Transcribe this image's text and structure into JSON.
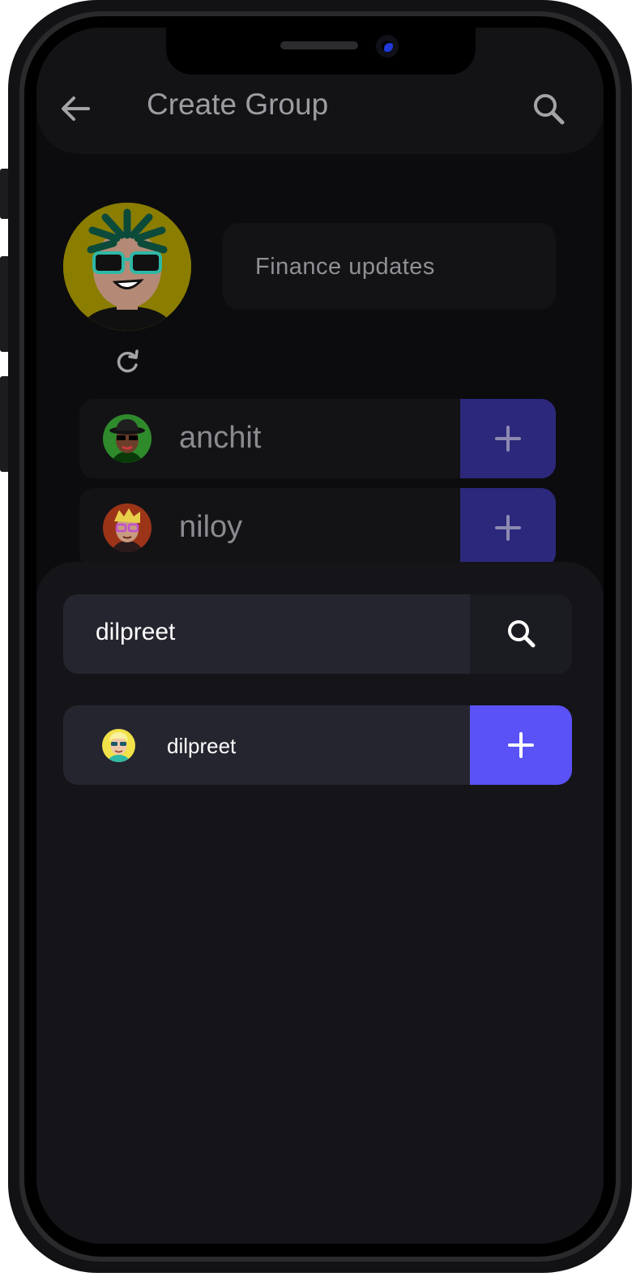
{
  "header": {
    "title": "Create Group",
    "back_icon": "arrow-left-icon",
    "search_icon": "search-icon"
  },
  "group": {
    "avatar_icon": "avatar-dreadlocks-sunglasses",
    "refresh_icon": "refresh-icon",
    "name_value": "Finance updates"
  },
  "members": [
    {
      "name": "anchit",
      "avatar": "avatar-hat-sunglasses",
      "action_icon": "plus-icon"
    },
    {
      "name": "niloy",
      "avatar": "avatar-blonde-glasses",
      "action_icon": "plus-icon"
    }
  ],
  "search": {
    "query": "dilpreet",
    "button_icon": "search-icon"
  },
  "results": [
    {
      "name": "dilpreet",
      "avatar": "avatar-yellow-sunglasses",
      "action_icon": "plus-icon"
    }
  ],
  "colors": {
    "accent": "#5a52f7",
    "accent_dim": "#2c287c",
    "background": "#0c0c0f",
    "card": "#131316",
    "sheet": "#151519",
    "field": "#25252f"
  }
}
